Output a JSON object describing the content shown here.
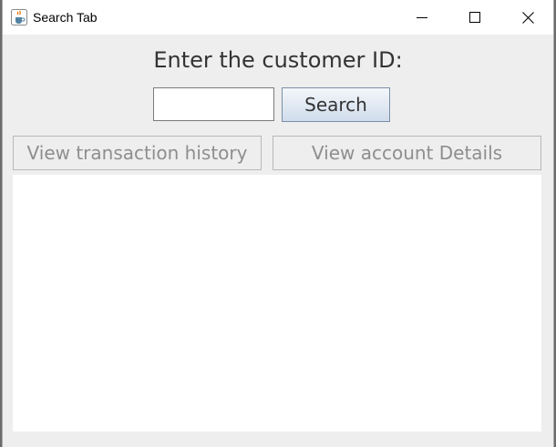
{
  "window": {
    "title": "Search Tab",
    "icon": "java-coffee-icon",
    "controls": [
      "minimize-icon",
      "maximize-icon",
      "close-icon"
    ]
  },
  "search": {
    "prompt": "Enter the customer ID:",
    "input_value": "",
    "button_label": "Search"
  },
  "tabs": {
    "history_label": "View transaction history",
    "details_label": "View account Details"
  },
  "colors": {
    "panel_bg": "#eeeeee",
    "disabled_text": "#8e8e8e",
    "search_button_gradient_top": "#f4f7fb",
    "search_button_gradient_bottom": "#d0dceb"
  }
}
